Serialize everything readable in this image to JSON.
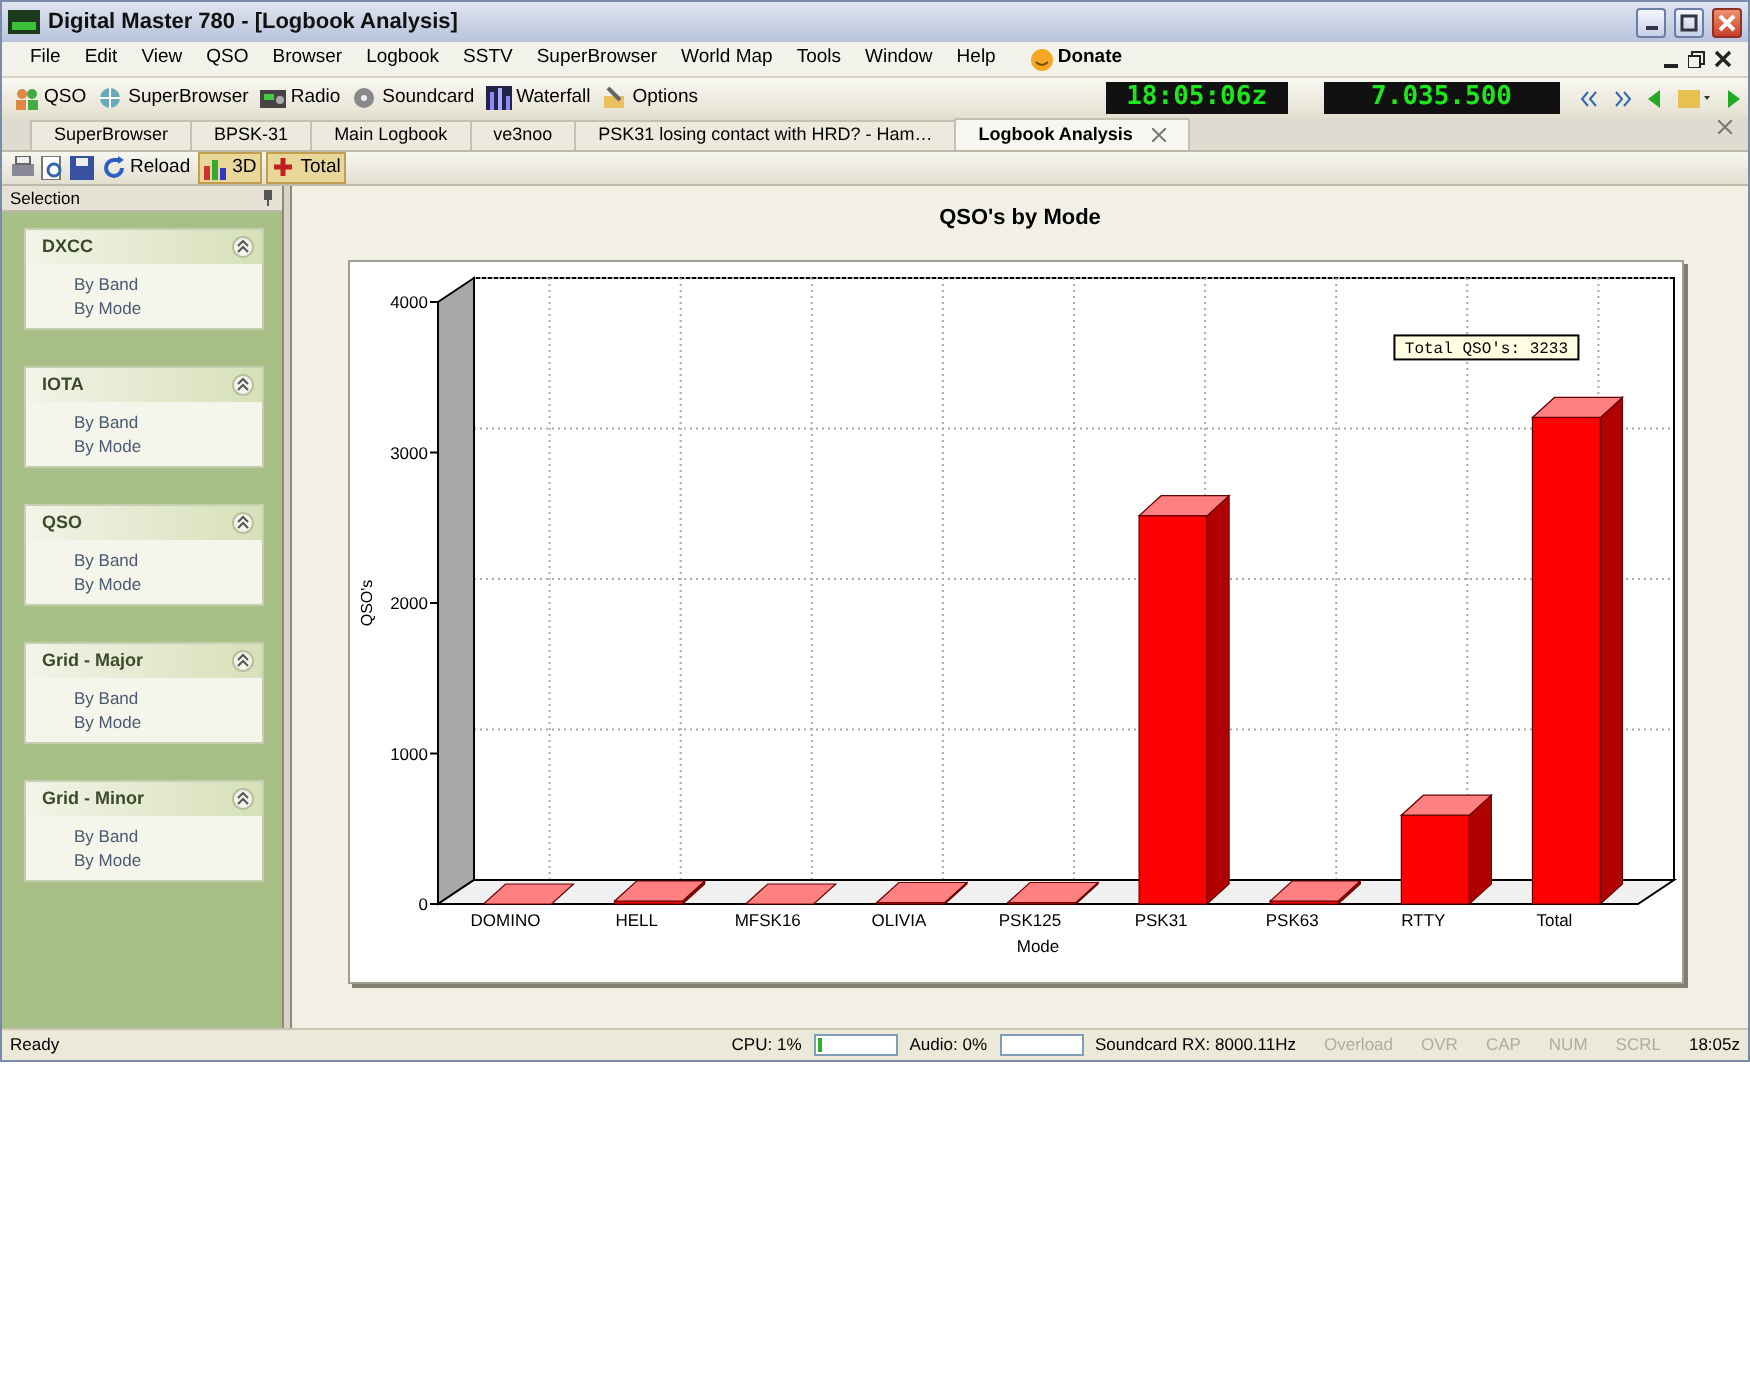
{
  "window": {
    "title": "Digital Master 780 - [Logbook Analysis]"
  },
  "menu": [
    "File",
    "Edit",
    "View",
    "QSO",
    "Browser",
    "Logbook",
    "SSTV",
    "SuperBrowser",
    "World Map",
    "Tools",
    "Window",
    "Help"
  ],
  "donate": "Donate",
  "toolbar": [
    "QSO",
    "SuperBrowser",
    "Radio",
    "Soundcard",
    "Waterfall",
    "Options"
  ],
  "clock": "18:05:06z",
  "frequency": "7.035.500",
  "tabs": [
    {
      "label": "SuperBrowser",
      "selected": false
    },
    {
      "label": "BPSK-31",
      "selected": false
    },
    {
      "label": "Main Logbook",
      "selected": false
    },
    {
      "label": "ve3noo",
      "selected": false
    },
    {
      "label": "PSK31 losing contact with HRD? - Ham…",
      "selected": false
    },
    {
      "label": "Logbook Analysis",
      "selected": true
    }
  ],
  "doc_toolbar": [
    {
      "label": "Reload",
      "pressed": false
    },
    {
      "label": "3D",
      "pressed": true
    },
    {
      "label": "Total",
      "pressed": true
    }
  ],
  "sidebar": {
    "title": "Selection",
    "sections": [
      {
        "title": "DXCC",
        "expanded": true,
        "items": [
          "By Band",
          "By Mode"
        ]
      },
      {
        "title": "IOTA",
        "expanded": true,
        "items": [
          "By Band",
          "By Mode"
        ]
      },
      {
        "title": "QSO",
        "expanded": true,
        "items": [
          "By Band",
          "By Mode"
        ]
      },
      {
        "title": "Grid - Major",
        "expanded": true,
        "items": [
          "By Band",
          "By Mode"
        ]
      },
      {
        "title": "Grid - Minor",
        "expanded": true,
        "items": [
          "By Band",
          "By Mode"
        ]
      }
    ]
  },
  "chart": {
    "chart_data": {
      "type": "bar",
      "title": "QSO's by Mode",
      "xlabel": "Mode",
      "ylabel": "QSO's",
      "categories": [
        "DOMINO",
        "HELL",
        "MFSK16",
        "OLIVIA",
        "PSK125",
        "PSK31",
        "PSK63",
        "RTTY",
        "Total"
      ],
      "values": [
        0,
        20,
        0,
        10,
        10,
        2580,
        20,
        590,
        3233
      ],
      "ylim": [
        0,
        4000
      ],
      "yticks": [
        0,
        1000,
        2000,
        3000,
        4000
      ],
      "annotations": [
        "Total QSO's: 3233"
      ]
    }
  },
  "status_bar": {
    "message": "Ready",
    "cpu": {
      "label": "CPU: 1%",
      "level": 0.05
    },
    "audio": {
      "label": "Audio: 0%",
      "level": 0
    },
    "soundcard": "Soundcard RX: 8000.11Hz",
    "indicators": [
      {
        "label": "Overload",
        "on": false
      },
      {
        "label": "OVR",
        "on": false
      },
      {
        "label": "CAP",
        "on": false
      },
      {
        "label": "NUM",
        "on": false
      },
      {
        "label": "SCRL",
        "on": false
      }
    ],
    "time": "18:05z"
  }
}
